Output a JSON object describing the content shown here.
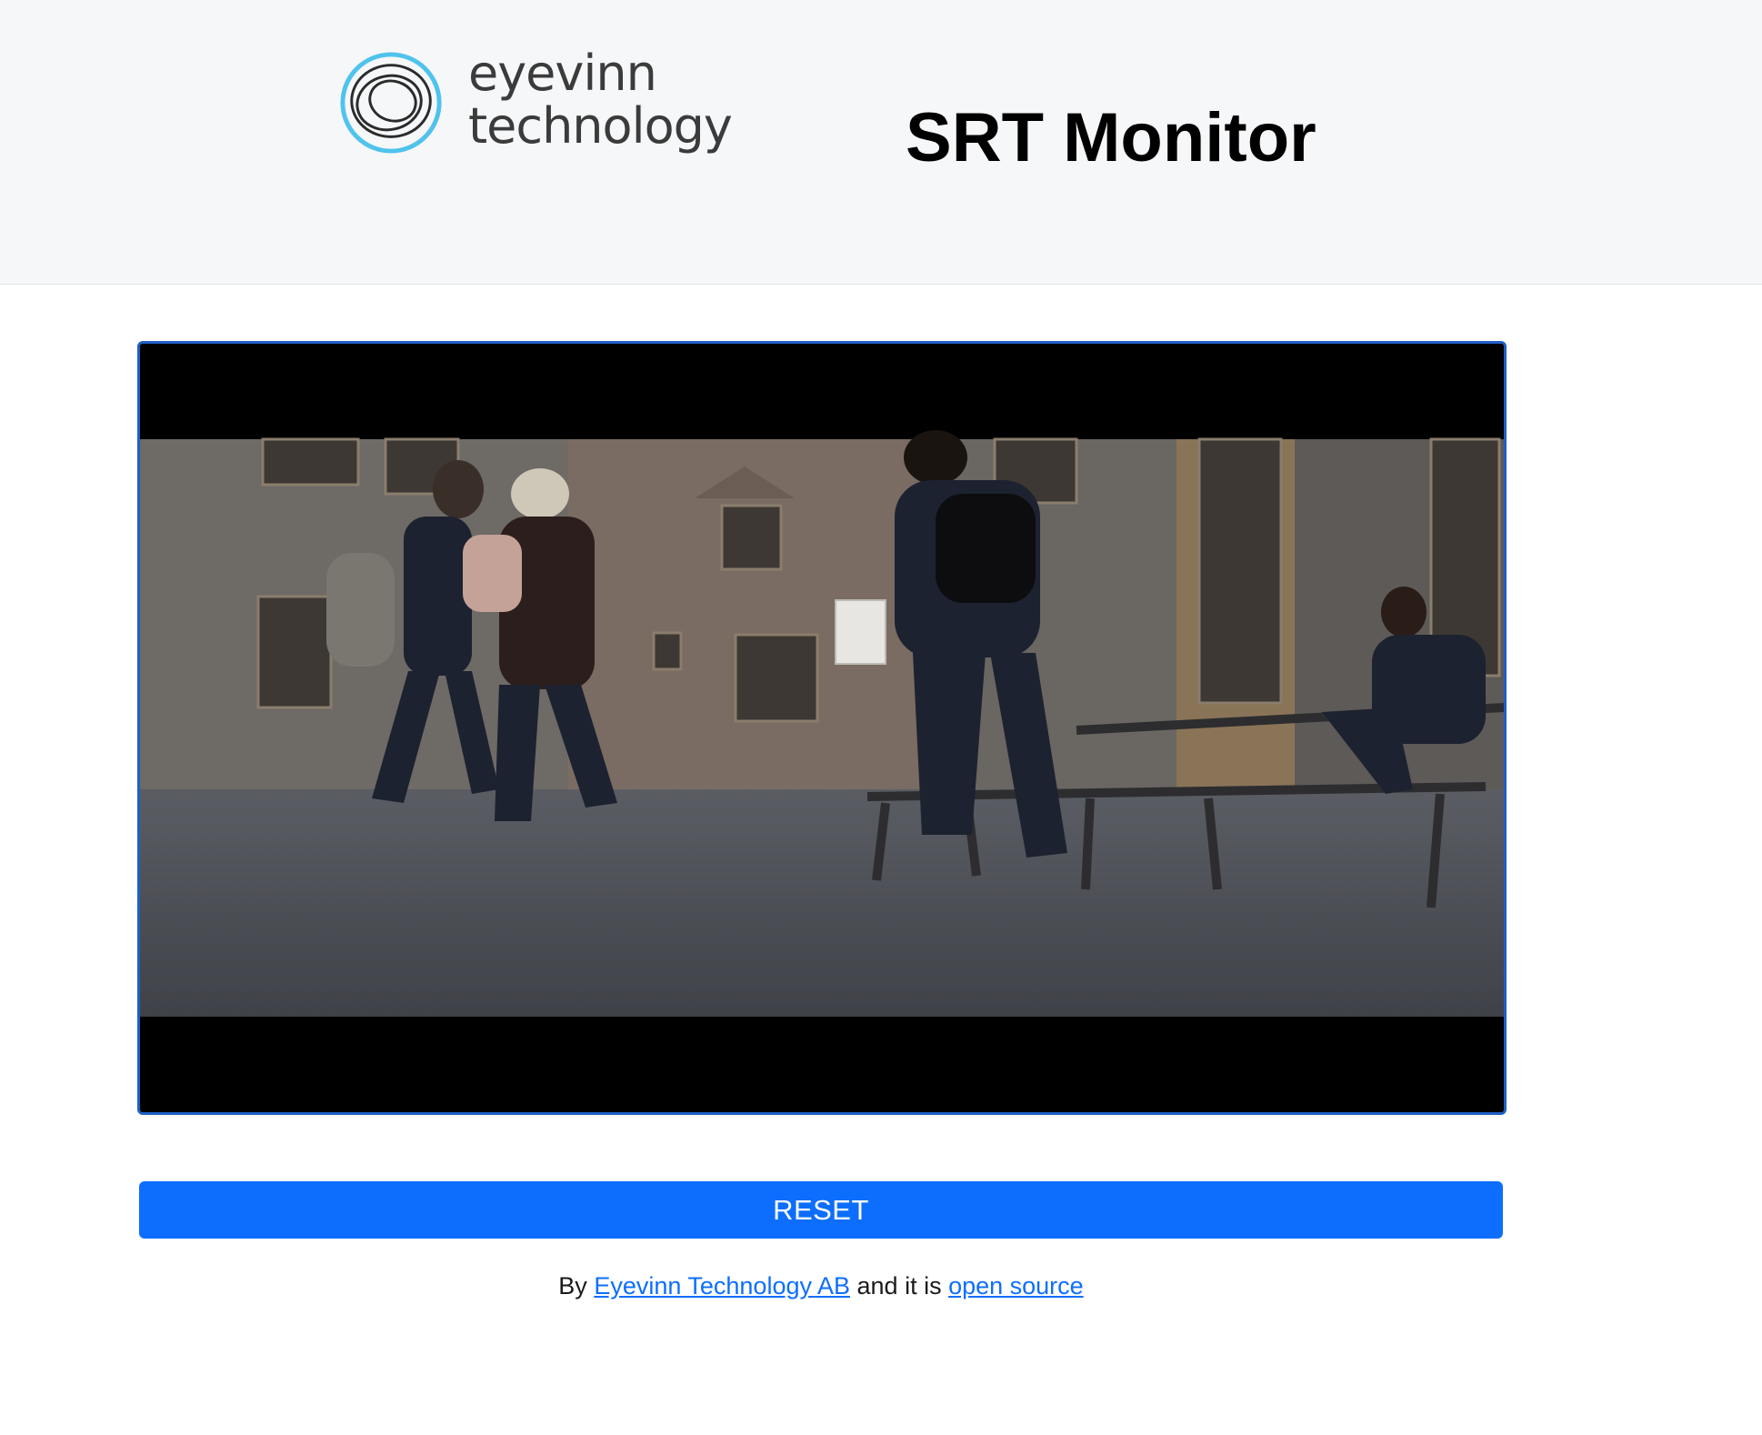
{
  "header": {
    "logo": {
      "line1": "eyevinn",
      "line2": "technology",
      "icon": "eyevinn-circle-logo-icon"
    },
    "title": "SRT Monitor"
  },
  "player": {
    "icon": "video-frame"
  },
  "reset_button": {
    "label": "RESET"
  },
  "footer": {
    "prefix": "By ",
    "company_link": "Eyevinn Technology AB",
    "middle": " and it is ",
    "source_link": "open source"
  },
  "colors": {
    "accent": "#0d6efd",
    "player_border": "#1f5fc4",
    "header_bg": "#f6f7f9"
  }
}
